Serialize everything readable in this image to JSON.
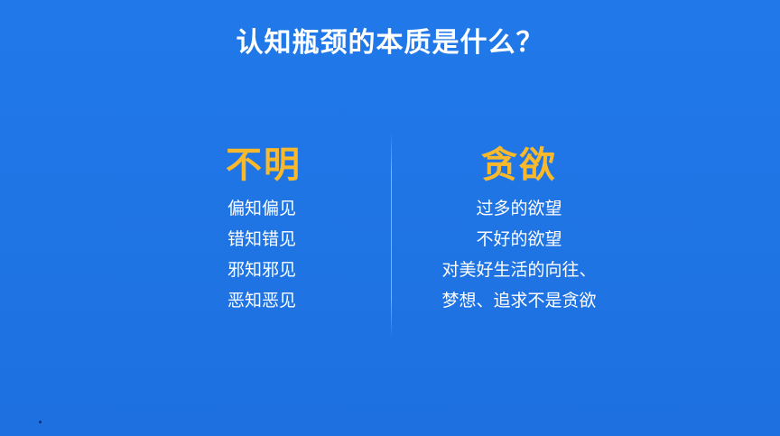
{
  "title": "认知瓶颈的本质是什么？",
  "left": {
    "heading": "不明",
    "items": [
      "偏知偏见",
      "错知错见",
      "邪知邪见",
      "恶知恶见"
    ]
  },
  "right": {
    "heading": "贪欲",
    "items": [
      "过多的欲望",
      "不好的欲望",
      "对美好生活的向往、",
      "梦想、追求不是贪欲"
    ]
  },
  "colors": {
    "background": "#1f74e4",
    "heading_accent": "#f9b92b",
    "text": "#ffffff"
  }
}
